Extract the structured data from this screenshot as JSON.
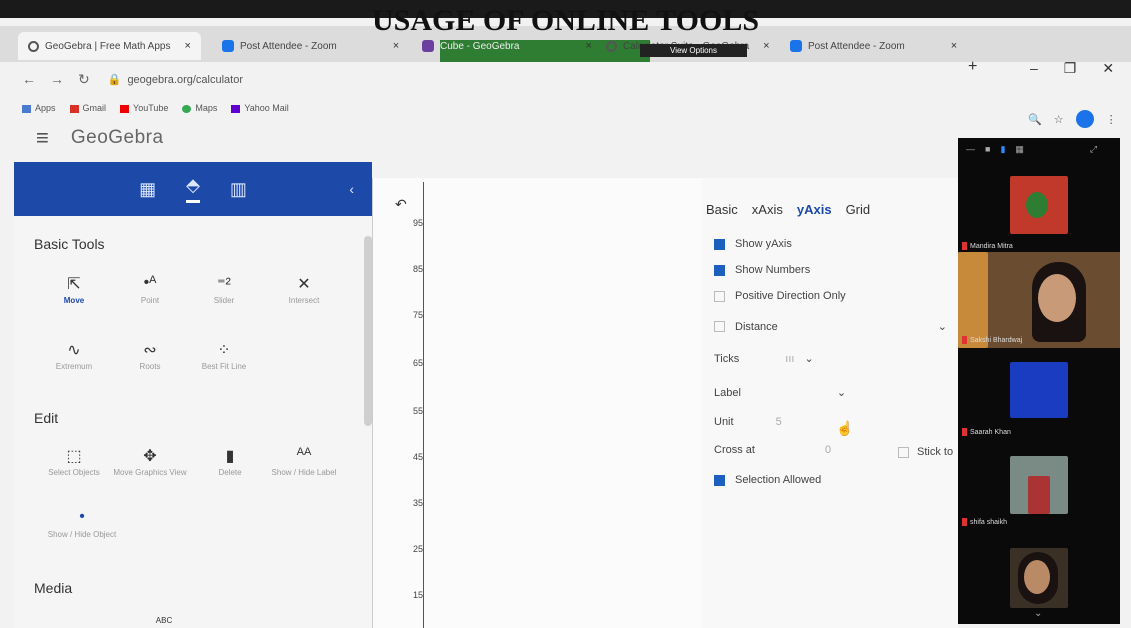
{
  "slide_title": "USAGE OF ONLINE TOOLS",
  "browser": {
    "tabs": [
      {
        "label": "GeoGebra | Free Math Apps",
        "icon": "geogebra-icon"
      },
      {
        "label": "Post Attendee - Zoom",
        "icon": "zoom-icon"
      },
      {
        "label": "Cube - GeoGebra",
        "icon": "geogebra-cube-icon"
      },
      {
        "label": "Calculator Suite - GeoGebra",
        "icon": "geogebra-icon"
      },
      {
        "label": "Post Attendee - Zoom",
        "icon": "zoom-icon"
      }
    ],
    "view_options": "View Options",
    "url": "geogebra.org/calculator",
    "bookmarks": [
      "Apps",
      "Gmail",
      "YouTube",
      "Maps",
      "Yahoo Mail"
    ]
  },
  "geogebra": {
    "brand": "GeoGebra",
    "sections": {
      "basic": "Basic Tools",
      "edit": "Edit",
      "media": "Media"
    },
    "basic_tools": [
      {
        "label": "Move",
        "icon": "cursor-icon"
      },
      {
        "label": "Point",
        "icon": "point-icon"
      },
      {
        "label": "Slider",
        "icon": "slider-icon"
      },
      {
        "label": "Intersect",
        "icon": "intersect-icon"
      },
      {
        "label": "Extremum",
        "icon": "extremum-icon"
      },
      {
        "label": "Roots",
        "icon": "roots-icon"
      },
      {
        "label": "Best Fit Line",
        "icon": "best-fit-icon"
      }
    ],
    "edit_tools": [
      {
        "label": "Select Objects",
        "icon": "select-icon"
      },
      {
        "label": "Move Graphics View",
        "icon": "move-view-icon"
      },
      {
        "label": "Delete",
        "icon": "trash-icon"
      },
      {
        "label": "Show / Hide Label",
        "icon": "label-icon"
      },
      {
        "label": "Show / Hide Object",
        "icon": "dot-icon"
      }
    ],
    "media_tool": "ABC",
    "y_ticks": [
      "95",
      "85",
      "75",
      "65",
      "55",
      "45",
      "35",
      "25",
      "15"
    ],
    "settings": {
      "tabs": [
        "Basic",
        "xAxis",
        "yAxis",
        "Grid"
      ],
      "active_tab": "yAxis",
      "show_yaxis": "Show yAxis",
      "show_numbers": "Show Numbers",
      "positive_only": "Positive Direction Only",
      "distance": "Distance",
      "ticks": "Ticks",
      "label": "Label",
      "unit": "Unit",
      "unit_value": "5",
      "cross_at": "Cross at",
      "cross_value": "0",
      "stick_to": "Stick to",
      "selection_allowed": "Selection Allowed"
    }
  },
  "zoom": {
    "participants": [
      "Mandira Mitra",
      "Sakshi Bhardwaj",
      "Saarah Khan",
      "shifa shaikh",
      ""
    ]
  }
}
